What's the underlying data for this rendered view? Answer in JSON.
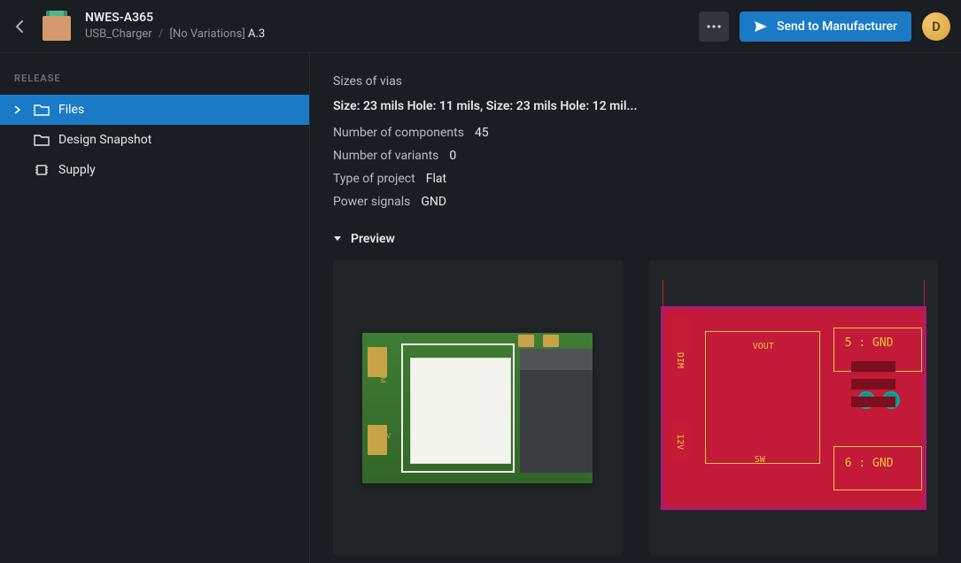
{
  "header": {
    "project_title": "NWES-A365",
    "breadcrumb_item1": "USB_Charger",
    "breadcrumb_item2": "[No Variations]",
    "breadcrumb_rev": "A.3",
    "send_label": "Send to Manufacturer",
    "avatar_initial": "D"
  },
  "sidebar": {
    "heading": "RELEASE",
    "items": [
      {
        "label": "Files"
      },
      {
        "label": "Design Snapshot"
      },
      {
        "label": "Supply"
      }
    ]
  },
  "details": {
    "sizes_label": "Sizes of vias",
    "sizes_value": "Size: 23 mils Hole: 11 mils, Size: 23 mils Hole: 12 mil...",
    "rows": [
      {
        "k": "Number of components",
        "v": "45"
      },
      {
        "k": "Number of variants",
        "v": "0"
      },
      {
        "k": "Type of project",
        "v": "Flat"
      },
      {
        "k": "Power signals",
        "v": "GND"
      }
    ],
    "preview_label": "Preview"
  },
  "pcb_labels": {
    "dim": "DIM",
    "v12": "12V",
    "vout": "VOUT",
    "sw": "SW",
    "gnd5": "5 : GND",
    "gnd6": "6 : GND"
  }
}
